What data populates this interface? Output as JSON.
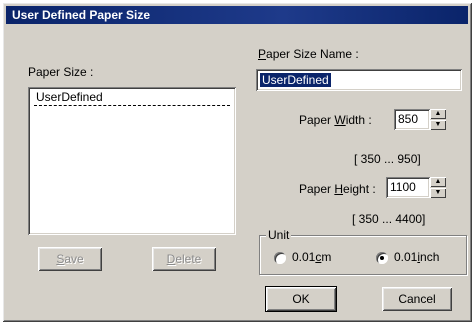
{
  "window": {
    "title": "User Defined Paper Size"
  },
  "paper_size": {
    "label": "Paper Size :",
    "items": [
      "UserDefined"
    ]
  },
  "paper_size_name": {
    "label_prefix": "",
    "label_ul": "P",
    "label_rest": "aper Size Name :",
    "value": "UserDefined"
  },
  "paper_width": {
    "label_pre": "Paper ",
    "label_ul": "W",
    "label_post": "idth  :",
    "value": "850",
    "range": "[  350  ...   950]"
  },
  "paper_height": {
    "label_pre": "Paper ",
    "label_ul": "H",
    "label_post": "eight :",
    "value": "1100",
    "range": "[  350  ...  4400]"
  },
  "buttons": {
    "save_ul": "S",
    "save_rest": "ave",
    "delete_ul": "D",
    "delete_rest": "elete",
    "ok": "OK",
    "cancel": "Cancel"
  },
  "unit": {
    "label": "Unit",
    "option1_pre": "0.01",
    "option1_ul": "c",
    "option1_post": "m",
    "option2_pre": "0.01",
    "option2_ul": "i",
    "option2_post": "nch",
    "selected": "0.01inch"
  },
  "icons": {
    "spin_up": "up-arrow-icon",
    "spin_down": "down-arrow-icon"
  },
  "colors": {
    "titlebar": "#0a246a",
    "dialog_bg": "#d4d0c8",
    "selection": "#0a246a"
  }
}
